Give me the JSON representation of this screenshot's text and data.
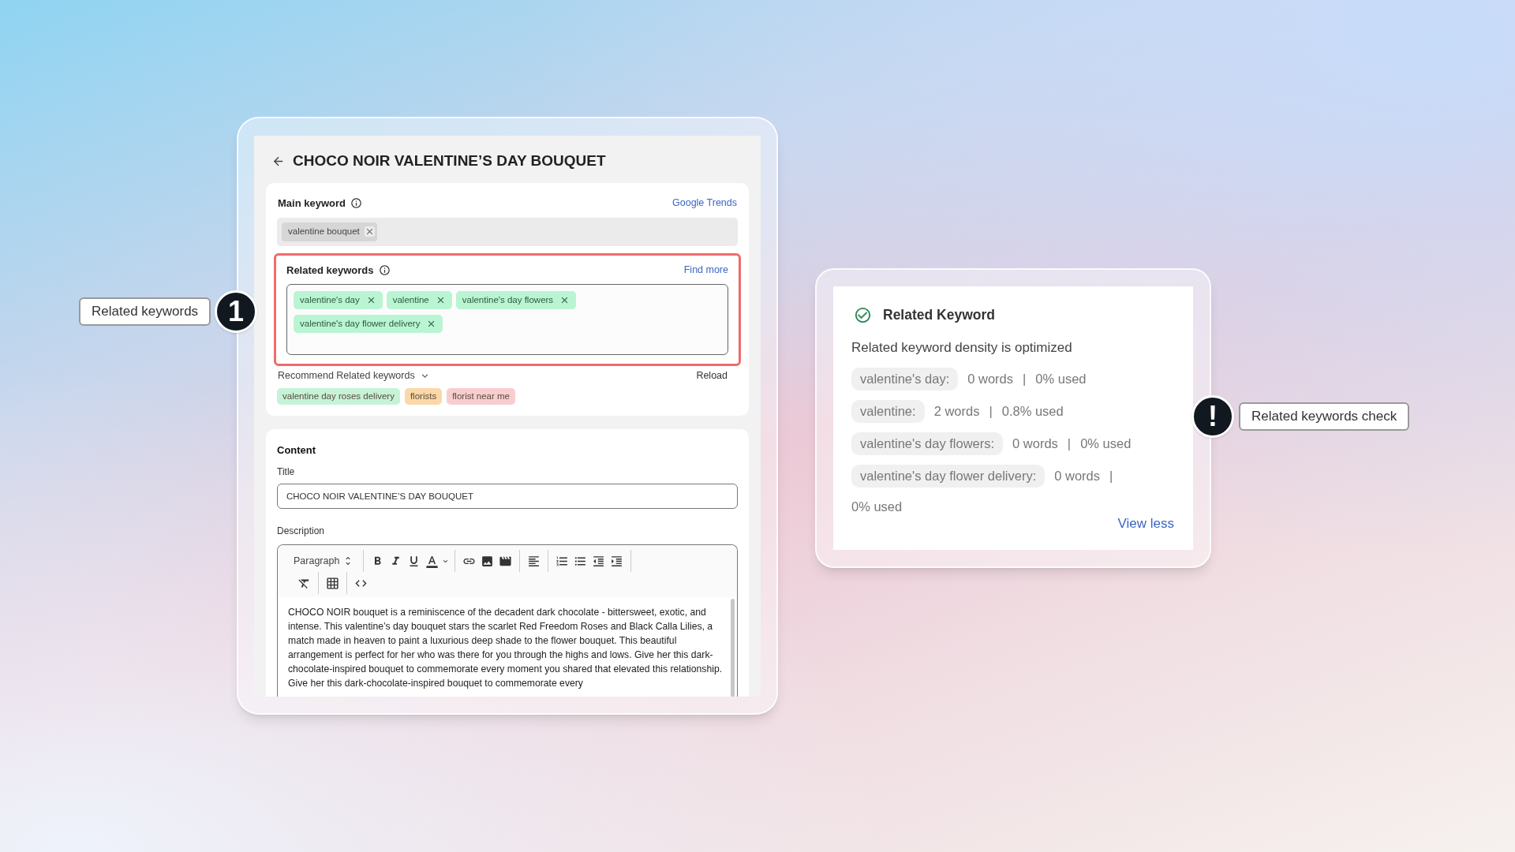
{
  "window": {
    "title": "CHOCO NOIR VALENTINE’S DAY BOUQUET"
  },
  "main_keyword": {
    "label": "Main keyword",
    "link": "Google Trends",
    "tags": [
      "valentine bouquet"
    ]
  },
  "related_keywords": {
    "label": "Related keywords",
    "link": "Find more",
    "highlighted": true,
    "tags": [
      "valentine's day",
      "valentine",
      "valentine's day flowers",
      "valentine's day flower delivery"
    ]
  },
  "recommend": {
    "label": "Recommend Related keywords",
    "action": "Reload",
    "tags": [
      {
        "text": "valentine day roses delivery",
        "color": "#c6f3d8"
      },
      {
        "text": "florists",
        "color": "#fbd8a8"
      },
      {
        "text": "florist near me",
        "color": "#f8cdd0"
      }
    ]
  },
  "content": {
    "heading": "Content",
    "title_label": "Title",
    "title_value": "CHOCO NOIR VALENTINE’S DAY BOUQUET",
    "description_label": "Description",
    "format": "Paragraph",
    "description": "CHOCO NOIR bouquet is a reminiscence of the decadent dark chocolate - bittersweet, exotic, and intense. This valentine’s day bouquet stars the scarlet Red Freedom Roses and Black Calla Lilies, a match made in heaven to paint a luxurious deep shade to the flower bouquet. This beautiful arrangement is perfect for her who was there for you through the highs and lows. Give her this dark-chocolate-inspired bouquet to commemorate every moment you shared that elevated this relationship. Give her this dark-chocolate-inspired bouquet to commemorate every"
  },
  "check_card": {
    "title": "Related Keyword",
    "summary": "Related keyword density is optimized",
    "rows": [
      {
        "keyword": "valentine's day:",
        "words": "0 words",
        "separator": "|",
        "used": "0% used"
      },
      {
        "keyword": "valentine:",
        "words": "2 words",
        "separator": "|",
        "used": "0.8% used"
      },
      {
        "keyword": "valentine's day flowers:",
        "words": "0 words",
        "separator": "|",
        "used": "0% used"
      },
      {
        "keyword": "valentine's day flower delivery:",
        "words": "0 words",
        "separator": "|",
        "used": "0% used"
      }
    ],
    "link": "View less"
  },
  "callouts": [
    {
      "kind": "left",
      "marker": "1",
      "label": "Related keywords"
    },
    {
      "kind": "right",
      "marker": "!",
      "label": "Related keywords check"
    }
  ]
}
